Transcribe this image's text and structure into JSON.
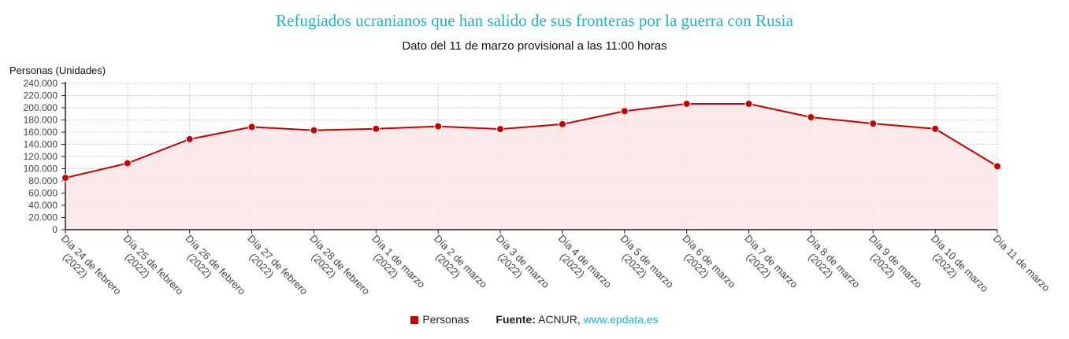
{
  "title": "Refugiados ucranianos que han salido de sus fronteras por la guerra con Rusia",
  "subtitle": "Dato del 11 de marzo provisional a las 11:00 horas",
  "legend": {
    "series_label": "Personas",
    "source_label": "Fuente:",
    "source_text": " ACNUR, ",
    "source_link": "www.epdata.es"
  },
  "colors": {
    "series": "#c80000",
    "fill": "#fbe6e6",
    "title": "#1fb4c4",
    "link": "#1fb4c4"
  },
  "chart_data": {
    "type": "area",
    "ylabel": "Personas (Unidades)",
    "ylim": [
      0,
      240000
    ],
    "yticks": [
      "0",
      "20.000",
      "40.000",
      "60.000",
      "80.000",
      "100.000",
      "120.000",
      "140.000",
      "160.000",
      "180.000",
      "200.000",
      "220.000",
      "240.000"
    ],
    "grid": true,
    "legend_position": "bottom",
    "categories": [
      [
        "Día 24 de febrero",
        "(2022)"
      ],
      [
        "Día 25 de febrero",
        "(2022)"
      ],
      [
        "Día 26 de febrero",
        "(2022)"
      ],
      [
        "Día 27 de febrero",
        "(2022)"
      ],
      [
        "Día 28 de febrero",
        "(2022)"
      ],
      [
        "Día 1 de marzo",
        "(2022)"
      ],
      [
        "Día 2 de marzo",
        "(2022)"
      ],
      [
        "Día 3 de marzo",
        "(2022)"
      ],
      [
        "Día 4 de marzo",
        "(2022)"
      ],
      [
        "Día 5 de marzo",
        "(2022)"
      ],
      [
        "Día 6 de marzo",
        "(2022)"
      ],
      [
        "Día 7 de marzo",
        "(2022)"
      ],
      [
        "Día 8 de marzo",
        "(2022)"
      ],
      [
        "Día 9 de marzo",
        "(2022)"
      ],
      [
        "Día 10 de marzo",
        "(2022)"
      ],
      [
        "Día 11 de marzo"
      ]
    ],
    "series": [
      {
        "name": "Personas",
        "values": [
          85000,
          109000,
          148500,
          168500,
          163000,
          165500,
          169500,
          165000,
          173000,
          194500,
          206500,
          206500,
          184500,
          174000,
          165500,
          104000
        ]
      }
    ]
  }
}
